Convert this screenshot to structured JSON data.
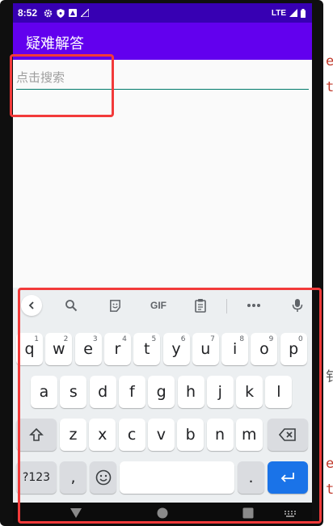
{
  "status_bar": {
    "time": "8:52",
    "network": "LTE"
  },
  "app_bar": {
    "title": "疑难解答"
  },
  "search": {
    "placeholder": "点击搜索",
    "value": ""
  },
  "keyboard": {
    "toolbar": {
      "gif_label": "GIF"
    },
    "row1": [
      {
        "key": "q",
        "hint": "1"
      },
      {
        "key": "w",
        "hint": "2"
      },
      {
        "key": "e",
        "hint": "3"
      },
      {
        "key": "r",
        "hint": "4"
      },
      {
        "key": "t",
        "hint": "5"
      },
      {
        "key": "y",
        "hint": "6"
      },
      {
        "key": "u",
        "hint": "7"
      },
      {
        "key": "i",
        "hint": "8"
      },
      {
        "key": "o",
        "hint": "9"
      },
      {
        "key": "p",
        "hint": "0"
      }
    ],
    "row2": [
      "a",
      "s",
      "d",
      "f",
      "g",
      "h",
      "j",
      "k",
      "l"
    ],
    "row3": [
      "z",
      "x",
      "c",
      "v",
      "b",
      "n",
      "m"
    ],
    "bottom": {
      "symbols": "?123",
      "comma": ",",
      "period": "."
    }
  },
  "side_text": {
    "top1": "e",
    "top2": "t",
    "mid": "钅",
    "bottom1": "e",
    "bottom2": "t"
  },
  "colors": {
    "status_bar": "#3700b3",
    "app_bar": "#6200ee",
    "accent": "#1a73e8",
    "underline": "#00796b",
    "highlight": "#f23a3a"
  }
}
